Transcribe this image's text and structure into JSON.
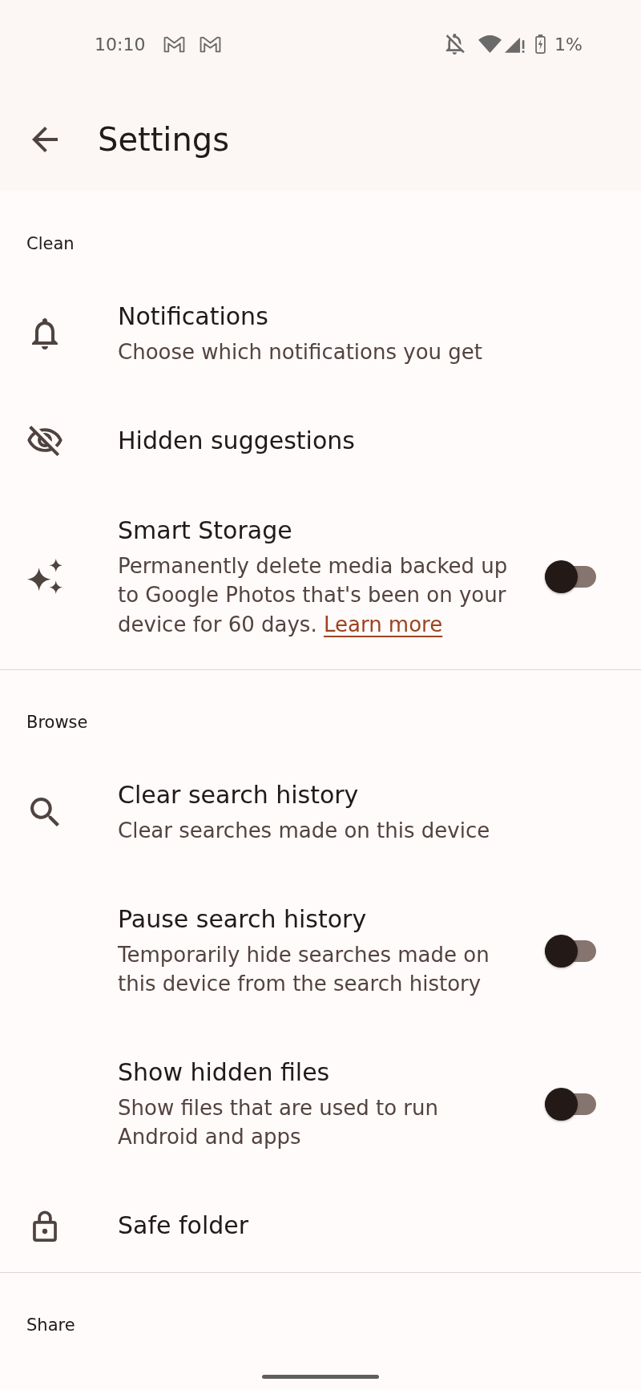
{
  "status_bar": {
    "time": "10:10",
    "battery": "1%"
  },
  "app_bar": {
    "title": "Settings"
  },
  "sections": [
    {
      "header": "Clean",
      "items": [
        {
          "kind": "plain",
          "title": "Notifications",
          "subtitle": "Choose which notifications you get"
        },
        {
          "kind": "plain",
          "title": "Hidden suggestions"
        },
        {
          "kind": "toggle",
          "title": "Smart Storage",
          "subtitle": "Permanently delete media backed up to Google Photos that's been on your device for 60 days.",
          "link": "Learn more",
          "on": false
        }
      ]
    },
    {
      "header": "Browse",
      "items": [
        {
          "kind": "plain",
          "title": "Clear search history",
          "subtitle": "Clear searches made on this device"
        },
        {
          "kind": "toggle",
          "title": "Pause search history",
          "subtitle": "Temporarily hide searches made on this device from the search history",
          "on": false
        },
        {
          "kind": "toggle",
          "title": "Show hidden files",
          "subtitle": "Show files that are used to run Android and apps",
          "on": false
        },
        {
          "kind": "plain",
          "title": "Safe folder"
        }
      ]
    },
    {
      "header": "Share"
    }
  ]
}
